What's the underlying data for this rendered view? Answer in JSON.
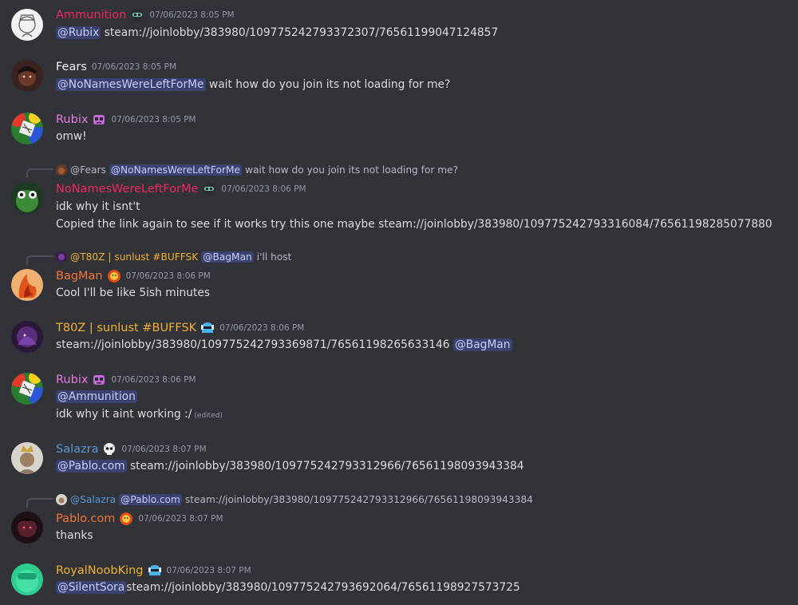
{
  "colors": {
    "background": "#313338",
    "text": "#dbdee1",
    "muted": "#949ba4",
    "mention_bg": "#3c4270",
    "mention_text": "#c9cdfb",
    "user_ammunition": "#ed2a5f",
    "user_fears": "#f2f3f5",
    "user_rubix": "#e67de3",
    "user_nonames": "#ed2a5f",
    "user_bagman": "#f5743a",
    "user_t80z": "#f0b132",
    "user_salazra": "#5b9bd5",
    "user_pablo": "#f5743a",
    "user_royal": "#f0b132"
  },
  "messages": [
    {
      "username": "Ammunition",
      "role_icon": "goggles-icon",
      "timestamp": "07/06/2023 8:05 PM",
      "mention": "@Rubix",
      "text": " steam://joinlobby/383980/109775242793372307/76561199047124857"
    },
    {
      "username": "Fears",
      "timestamp": "07/06/2023 8:05 PM",
      "mention": "@NoNamesWereLeftForMe",
      "text": " wait how do you join its not loading for me?"
    },
    {
      "username": "Rubix",
      "role_icon": "robot-icon",
      "timestamp": "07/06/2023 8:05 PM",
      "text": "omw!"
    },
    {
      "reply": {
        "user": "@Fears",
        "mention": "@NoNamesWereLeftForMe",
        "text": "wait how do you join its not loading for me?"
      },
      "username": "NoNamesWereLeftForMe",
      "role_icon": "goggles-icon",
      "timestamp": "07/06/2023 8:06 PM",
      "line1": "idk why it isnt't",
      "line2": "Copied the link again to see if it works try this one maybe steam://joinlobby/383980/109775242793316084/76561198285077880"
    },
    {
      "reply": {
        "user": "@T80Z | sunlust #BUFFSK",
        "mention": "@BagMan",
        "text": "i'll host"
      },
      "username": "BagMan",
      "role_icon": "lion-icon",
      "timestamp": "07/06/2023 8:06 PM",
      "text": "Cool I'll be like 5ish minutes"
    },
    {
      "username": "T80Z | sunlust #BUFFSK",
      "role_icon": "helmet-icon",
      "timestamp": "07/06/2023 8:06 PM",
      "text": "steam://joinlobby/383980/109775242793369871/76561198265633146 ",
      "mention_after": "@BagMan"
    },
    {
      "username": "Rubix",
      "role_icon": "robot-icon",
      "timestamp": "07/06/2023 8:06 PM",
      "mention": "@Ammunition",
      "line2": "idk why it aint working :/",
      "edited": "(edited)"
    },
    {
      "username": "Salazra",
      "role_icon": "skull-icon",
      "timestamp": "07/06/2023 8:07 PM",
      "mention": "@Pablo.com",
      "text": " steam://joinlobby/383980/109775242793312966/76561198093943384"
    },
    {
      "reply": {
        "user": "@Salazra",
        "mention": "@Pablo.com",
        "text": "steam://joinlobby/383980/109775242793312966/76561198093943384"
      },
      "username": "Pablo.com",
      "role_icon": "lion-icon",
      "timestamp": "07/06/2023 8:07 PM",
      "text": "thanks"
    },
    {
      "username": "RoyalNoobKing",
      "role_icon": "helmet-icon",
      "timestamp": "07/06/2023 8:07 PM",
      "mention": "@SilentSora",
      "text": "steam://joinlobby/383980/109775242793692064/76561198927573725"
    }
  ]
}
